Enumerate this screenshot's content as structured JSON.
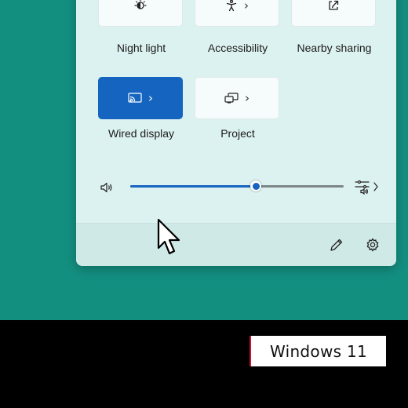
{
  "quick_settings": {
    "tiles_row1": [
      {
        "label": "Night light",
        "icon": "night-light-icon"
      },
      {
        "label": "Accessibility",
        "icon": "accessibility-icon"
      },
      {
        "label": "Nearby sharing",
        "icon": "share-icon"
      }
    ],
    "tiles_row2": [
      {
        "label": "Wired display",
        "icon": "cast-icon",
        "active": true
      },
      {
        "label": "Project",
        "icon": "project-icon",
        "active": false
      }
    ],
    "chevron": "›",
    "volume": {
      "icon": "speaker-icon",
      "level_percent": 59,
      "mixer_icon": "audio-mixer-icon"
    },
    "footer": {
      "edit_icon": "pencil-icon",
      "settings_icon": "gear-icon"
    }
  },
  "overlay": {
    "brand_text": "Windows 11"
  },
  "colors": {
    "desktop": "#138f80",
    "accent": "#1565c0",
    "panel": "#dcf2f0",
    "bottom_bar": "#000000"
  }
}
